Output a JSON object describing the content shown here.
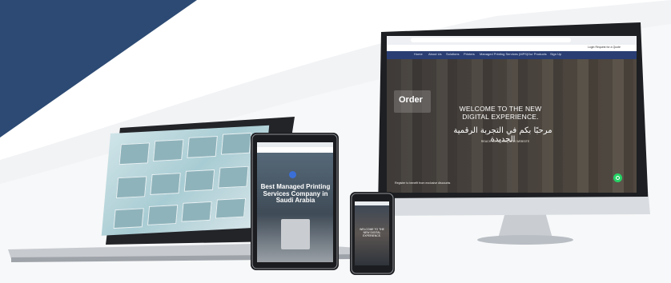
{
  "monitor": {
    "top_links": "Login   Request for a Quote",
    "nav_items": [
      "Home",
      "About Us",
      "Solutions",
      "Printers",
      "Managed Printing Services (MPS)",
      "Our Products",
      "Sign Up"
    ],
    "welcome_text": "WELCOME TO THE NEW DIGITAL EXPERIENCE.",
    "arabic_text": "مرحبًا بكم في التجربة الرقمية الجديدة",
    "sub_text": "REACH US ON OUR NEW WEBSITE",
    "bottom_text": "Register to benefit from exclusive discounts",
    "logo_text": "Order"
  },
  "tablet": {
    "title": "Best Managed Printing Services Company in Saudi Arabia"
  },
  "phone": {
    "title": "WELCOME TO THE NEW DIGITAL EXPERIENCE."
  },
  "colors": {
    "navy": "#2c4a73",
    "nav_bar": "#2a3e73",
    "whatsapp": "#25d366"
  },
  "icons": [
    "whatsapp-icon",
    "search-icon",
    "play-icon"
  ]
}
